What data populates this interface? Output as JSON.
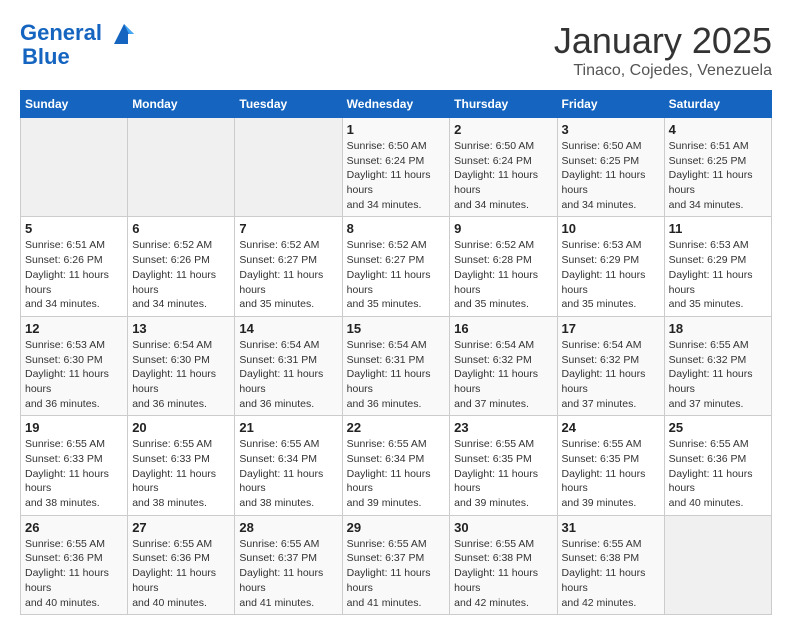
{
  "header": {
    "logo_line1": "General",
    "logo_line2": "Blue",
    "month": "January 2025",
    "location": "Tinaco, Cojedes, Venezuela"
  },
  "weekdays": [
    "Sunday",
    "Monday",
    "Tuesday",
    "Wednesday",
    "Thursday",
    "Friday",
    "Saturday"
  ],
  "weeks": [
    [
      {
        "day": "",
        "info": ""
      },
      {
        "day": "",
        "info": ""
      },
      {
        "day": "",
        "info": ""
      },
      {
        "day": "1",
        "info": "Sunrise: 6:50 AM\nSunset: 6:24 PM\nDaylight: 11 hours and 34 minutes."
      },
      {
        "day": "2",
        "info": "Sunrise: 6:50 AM\nSunset: 6:24 PM\nDaylight: 11 hours and 34 minutes."
      },
      {
        "day": "3",
        "info": "Sunrise: 6:50 AM\nSunset: 6:25 PM\nDaylight: 11 hours and 34 minutes."
      },
      {
        "day": "4",
        "info": "Sunrise: 6:51 AM\nSunset: 6:25 PM\nDaylight: 11 hours and 34 minutes."
      }
    ],
    [
      {
        "day": "5",
        "info": "Sunrise: 6:51 AM\nSunset: 6:26 PM\nDaylight: 11 hours and 34 minutes."
      },
      {
        "day": "6",
        "info": "Sunrise: 6:52 AM\nSunset: 6:26 PM\nDaylight: 11 hours and 34 minutes."
      },
      {
        "day": "7",
        "info": "Sunrise: 6:52 AM\nSunset: 6:27 PM\nDaylight: 11 hours and 35 minutes."
      },
      {
        "day": "8",
        "info": "Sunrise: 6:52 AM\nSunset: 6:27 PM\nDaylight: 11 hours and 35 minutes."
      },
      {
        "day": "9",
        "info": "Sunrise: 6:52 AM\nSunset: 6:28 PM\nDaylight: 11 hours and 35 minutes."
      },
      {
        "day": "10",
        "info": "Sunrise: 6:53 AM\nSunset: 6:29 PM\nDaylight: 11 hours and 35 minutes."
      },
      {
        "day": "11",
        "info": "Sunrise: 6:53 AM\nSunset: 6:29 PM\nDaylight: 11 hours and 35 minutes."
      }
    ],
    [
      {
        "day": "12",
        "info": "Sunrise: 6:53 AM\nSunset: 6:30 PM\nDaylight: 11 hours and 36 minutes."
      },
      {
        "day": "13",
        "info": "Sunrise: 6:54 AM\nSunset: 6:30 PM\nDaylight: 11 hours and 36 minutes."
      },
      {
        "day": "14",
        "info": "Sunrise: 6:54 AM\nSunset: 6:31 PM\nDaylight: 11 hours and 36 minutes."
      },
      {
        "day": "15",
        "info": "Sunrise: 6:54 AM\nSunset: 6:31 PM\nDaylight: 11 hours and 36 minutes."
      },
      {
        "day": "16",
        "info": "Sunrise: 6:54 AM\nSunset: 6:32 PM\nDaylight: 11 hours and 37 minutes."
      },
      {
        "day": "17",
        "info": "Sunrise: 6:54 AM\nSunset: 6:32 PM\nDaylight: 11 hours and 37 minutes."
      },
      {
        "day": "18",
        "info": "Sunrise: 6:55 AM\nSunset: 6:32 PM\nDaylight: 11 hours and 37 minutes."
      }
    ],
    [
      {
        "day": "19",
        "info": "Sunrise: 6:55 AM\nSunset: 6:33 PM\nDaylight: 11 hours and 38 minutes."
      },
      {
        "day": "20",
        "info": "Sunrise: 6:55 AM\nSunset: 6:33 PM\nDaylight: 11 hours and 38 minutes."
      },
      {
        "day": "21",
        "info": "Sunrise: 6:55 AM\nSunset: 6:34 PM\nDaylight: 11 hours and 38 minutes."
      },
      {
        "day": "22",
        "info": "Sunrise: 6:55 AM\nSunset: 6:34 PM\nDaylight: 11 hours and 39 minutes."
      },
      {
        "day": "23",
        "info": "Sunrise: 6:55 AM\nSunset: 6:35 PM\nDaylight: 11 hours and 39 minutes."
      },
      {
        "day": "24",
        "info": "Sunrise: 6:55 AM\nSunset: 6:35 PM\nDaylight: 11 hours and 39 minutes."
      },
      {
        "day": "25",
        "info": "Sunrise: 6:55 AM\nSunset: 6:36 PM\nDaylight: 11 hours and 40 minutes."
      }
    ],
    [
      {
        "day": "26",
        "info": "Sunrise: 6:55 AM\nSunset: 6:36 PM\nDaylight: 11 hours and 40 minutes."
      },
      {
        "day": "27",
        "info": "Sunrise: 6:55 AM\nSunset: 6:36 PM\nDaylight: 11 hours and 40 minutes."
      },
      {
        "day": "28",
        "info": "Sunrise: 6:55 AM\nSunset: 6:37 PM\nDaylight: 11 hours and 41 minutes."
      },
      {
        "day": "29",
        "info": "Sunrise: 6:55 AM\nSunset: 6:37 PM\nDaylight: 11 hours and 41 minutes."
      },
      {
        "day": "30",
        "info": "Sunrise: 6:55 AM\nSunset: 6:38 PM\nDaylight: 11 hours and 42 minutes."
      },
      {
        "day": "31",
        "info": "Sunrise: 6:55 AM\nSunset: 6:38 PM\nDaylight: 11 hours and 42 minutes."
      },
      {
        "day": "",
        "info": ""
      }
    ]
  ]
}
